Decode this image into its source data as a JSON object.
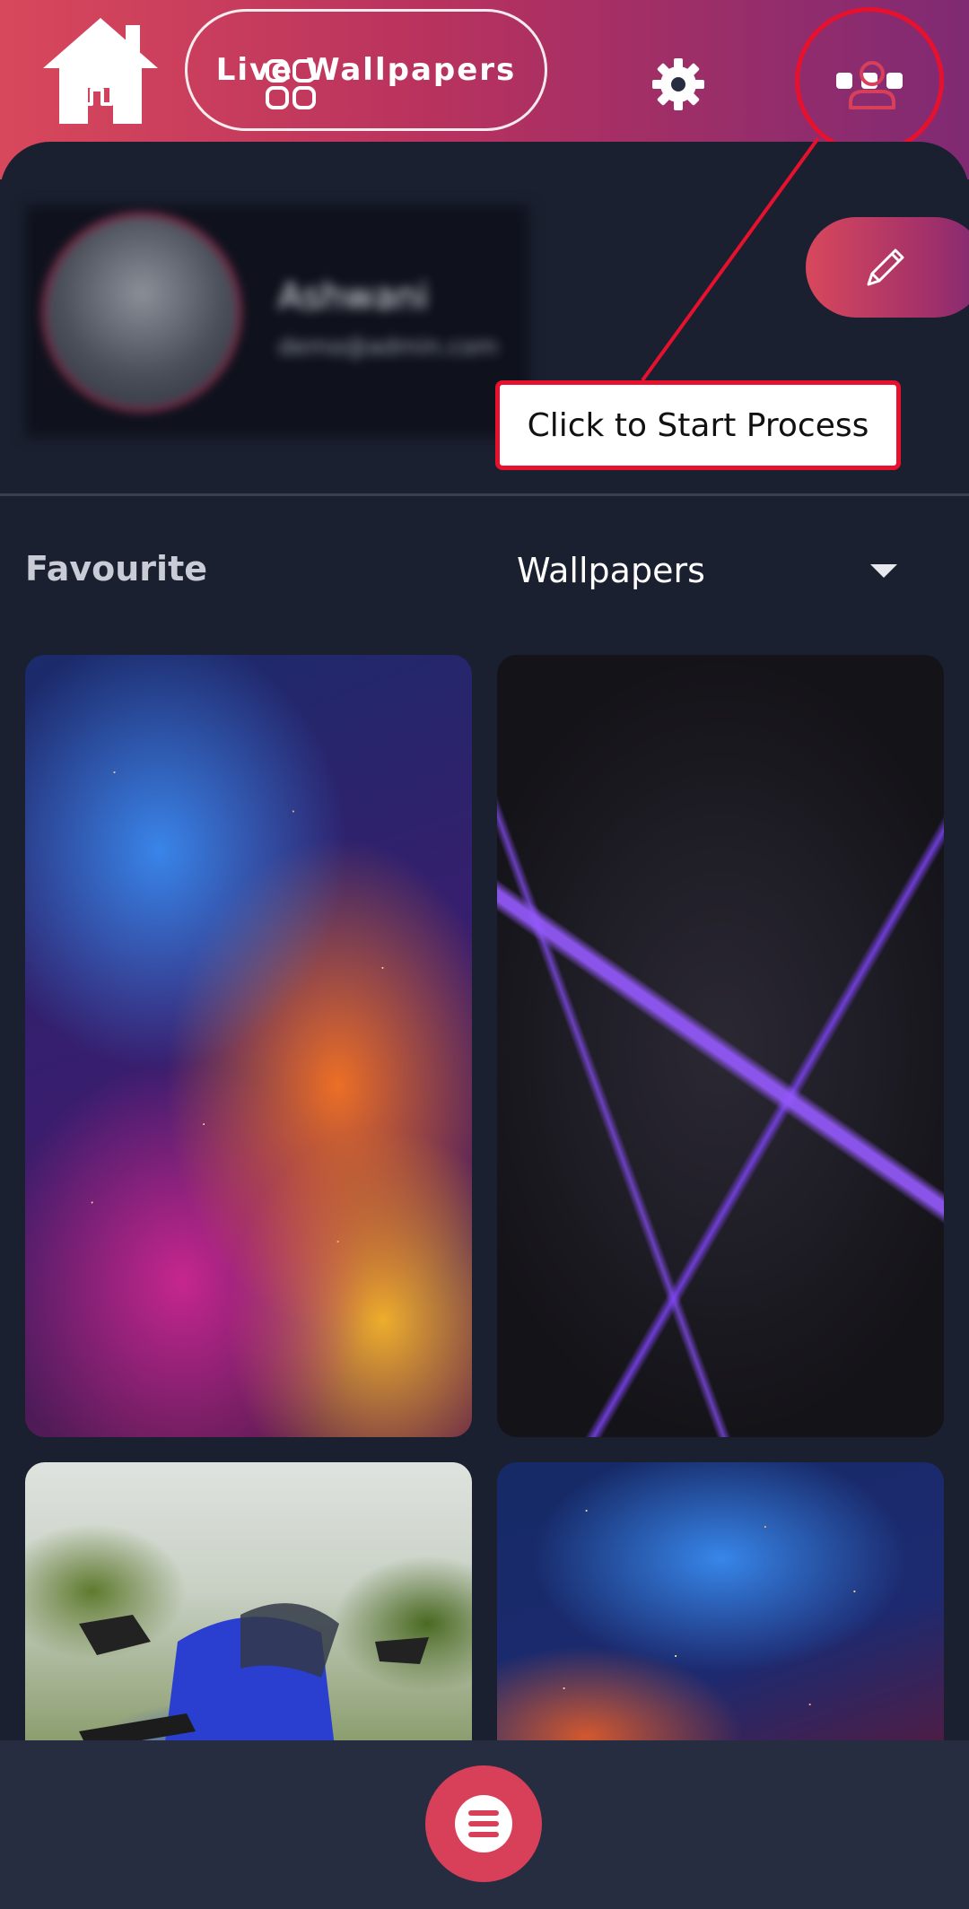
{
  "header": {
    "title": "Live Wallpapers",
    "home_icon": "home-icon",
    "more_icon": "more-dots-icon"
  },
  "profile": {
    "name": "Ashwani",
    "email": "demo@admin.com",
    "edit_icon": "pencil-icon"
  },
  "annotation": {
    "text": "Click to Start Process"
  },
  "filters": {
    "favourite_label": "Favourite",
    "category_selected": "Wallpapers"
  },
  "wallpapers": [
    {
      "name": "colorful-smoke-wallpaper"
    },
    {
      "name": "purple-neon-shards-wallpaper"
    },
    {
      "name": "blue-motorcycle-wallpaper"
    },
    {
      "name": "cosmic-smoke-wallpaper"
    }
  ],
  "bottom_nav": [
    {
      "icon": "home-icon"
    },
    {
      "icon": "grid-icon"
    },
    {
      "icon": "menu-icon"
    },
    {
      "icon": "gear-icon"
    },
    {
      "icon": "user-icon"
    }
  ],
  "colors": {
    "accent": "#d8405a",
    "header_gradient_start": "#d8485c",
    "header_gradient_end": "#7f2a73",
    "background": "#1b2030",
    "nav_background": "#272d40",
    "annotation_red": "#e8112d"
  }
}
